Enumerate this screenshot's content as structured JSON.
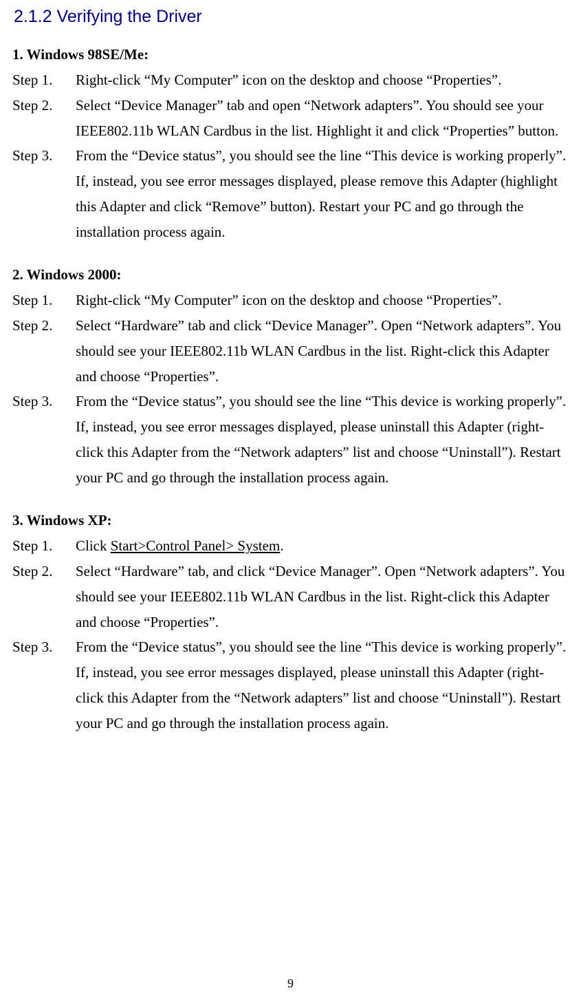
{
  "heading": "2.1.2 Verifying the Driver",
  "sections": [
    {
      "title": "1. Windows 98SE/Me:",
      "steps": [
        {
          "label": "Step 1.",
          "text": "Right-click “My Computer” icon on the desktop and choose “Properties”."
        },
        {
          "label": "Step 2.",
          "text": "Select “Device Manager” tab and open “Network adapters”.    You should see your IEEE802.11b WLAN Cardbus in the list.    Highlight it and click “Properties” button."
        },
        {
          "label": "Step 3.",
          "text": "From the “Device status”, you should see the line “This device is working properly”.    If, instead, you see error messages displayed, please remove this Adapter (highlight this Adapter and click “Remove” button).    Restart your PC and go through the installation process again."
        }
      ]
    },
    {
      "title": "2. Windows 2000:",
      "steps": [
        {
          "label": "Step 1.",
          "text": "Right-click “My Computer” icon on the desktop and choose “Properties”."
        },
        {
          "label": "Step 2.",
          "text": "Select “Hardware” tab and click “Device Manager”.    Open “Network adapters”.    You should see your IEEE802.11b WLAN Cardbus in the list.   Right-click this Adapter and choose “Properties”."
        },
        {
          "label": "Step 3.",
          "text": "From the “Device status”, you should see the line “This device is working properly”.    If, instead, you see error messages displayed, please uninstall this Adapter (right-click this Adapter from the “Network adapters” list and choose “Uninstall”).    Restart your PC and go through the installation process again."
        }
      ]
    },
    {
      "title": "3. Windows XP:",
      "steps": [
        {
          "label": "Step 1.",
          "text_pre": "Click ",
          "text_underline": "Start>Control Panel> System",
          "text_post": "."
        },
        {
          "label": "Step 2.",
          "text": "Select “Hardware” tab, and click “Device Manager”.    Open “Network adapters”.    You should see your IEEE802.11b WLAN Cardbus in the list.   Right-click this Adapter and choose “Properties”."
        },
        {
          "label": "Step 3.",
          "text": "From the “Device status”, you should see the line “This device is working properly”.    If, instead, you see error messages displayed, please uninstall this Adapter (right-click this Adapter from the “Network adapters” list and choose “Uninstall”).    Restart your PC and go through the installation process again."
        }
      ]
    }
  ],
  "page_number": "9"
}
